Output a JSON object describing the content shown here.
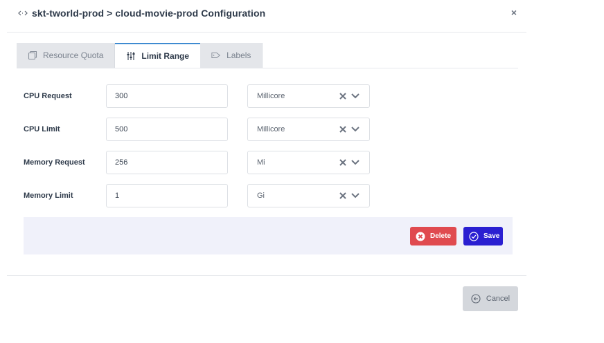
{
  "header": {
    "title": "skt-tworld-prod > cloud-movie-prod Configuration",
    "close_symbol": "×"
  },
  "tabs": [
    {
      "label": "Resource Quota",
      "icon": "copy-icon",
      "active": false
    },
    {
      "label": "Limit Range",
      "icon": "sliders-icon",
      "active": true
    },
    {
      "label": "Labels",
      "icon": "tag-icon",
      "active": false
    }
  ],
  "form": {
    "rows": [
      {
        "label": "CPU Request",
        "value": "300",
        "unit": "Millicore"
      },
      {
        "label": "CPU Limit",
        "value": "500",
        "unit": "Millicore"
      },
      {
        "label": "Memory Request",
        "value": "256",
        "unit": "Mi"
      },
      {
        "label": "Memory Limit",
        "value": "1",
        "unit": "Gi"
      }
    ]
  },
  "actions": {
    "delete_label": "Delete",
    "save_label": "Save",
    "cancel_label": "Cancel"
  },
  "colors": {
    "active_tab_accent": "#3f8bd1",
    "delete": "#e04a4f",
    "save": "#2a1fd1",
    "action_bar": "#f0f1fa"
  }
}
